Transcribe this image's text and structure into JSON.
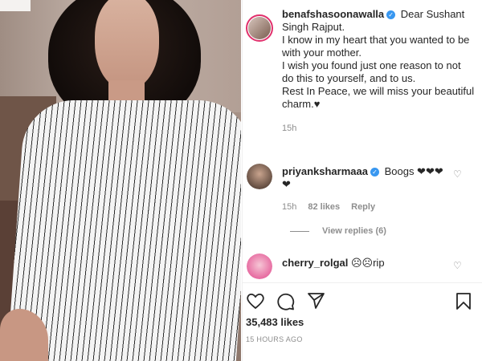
{
  "post": {
    "author": "benafshasoonawalla",
    "caption_lines": [
      "Dear Sushant Singh Rajput.",
      "I know in my heart that you wanted to be with your mother.",
      "I wish you found just one reason to not do this to yourself, and to us.",
      "Rest In Peace, we will miss your beautiful charm.♥"
    ],
    "caption_time": "15h"
  },
  "comments": [
    {
      "user": "priyanksharmaaa",
      "text": "Boogs ❤❤❤ ❤",
      "time": "15h",
      "likes": "82 likes",
      "reply": "Reply",
      "view_replies": "View replies (6)"
    },
    {
      "user": "cherry_rolgal",
      "text": "☹☹rip"
    }
  ],
  "footer": {
    "likes": "35,483 likes",
    "ago": "15 HOURS AGO"
  },
  "icons": {
    "like": "heart-outline-icon",
    "comment": "comment-bubble-icon",
    "share": "paper-plane-icon",
    "save": "bookmark-icon",
    "verified": "verified-badge-icon"
  },
  "colors": {
    "verified": "#3897f0",
    "story_ring": "#e1306c",
    "muted_text": "#8e8e8e"
  }
}
